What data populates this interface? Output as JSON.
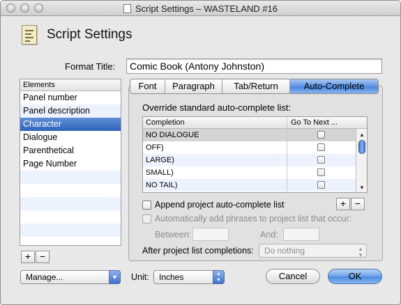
{
  "window": {
    "title": "Script Settings – WASTELAND #16"
  },
  "header": {
    "title": "Script Settings",
    "icon": "script-settings-icon"
  },
  "format_title": {
    "label": "Format Title:",
    "value": "Comic Book (Antony Johnston)"
  },
  "elements": {
    "header": "Elements",
    "items": [
      "Panel number",
      "Panel description",
      "Character",
      "Dialogue",
      "Parenthetical",
      "Page Number"
    ],
    "selected": "Character",
    "add_label": "+",
    "remove_label": "−"
  },
  "tabs": [
    "Font",
    "Paragraph",
    "Tab/Return",
    "Auto-Complete"
  ],
  "active_tab": "Auto-Complete",
  "auto_complete": {
    "override_label": "Override standard auto-complete list:",
    "columns": [
      "Completion",
      "Go To Next ..."
    ],
    "rows": [
      {
        "completion": "NO DIALOGUE",
        "go_to_next": false
      },
      {
        "completion": "OFF)",
        "go_to_next": false
      },
      {
        "completion": "LARGE)",
        "go_to_next": false
      },
      {
        "completion": "SMALL)",
        "go_to_next": false
      },
      {
        "completion": "NO TAIL)",
        "go_to_next": false
      }
    ],
    "add_label": "+",
    "remove_label": "−",
    "append_label": "Append project auto-complete list",
    "auto_add_label": "Automatically add phrases to project list that occur:",
    "between_label": "Between:",
    "and_label": "And:",
    "between_value": "",
    "and_value": "",
    "after_label": "After project list completions:",
    "after_value": "Do nothing"
  },
  "footer": {
    "manage_label": "Manage...",
    "unit_label": "Unit:",
    "unit_value": "Inches",
    "cancel_label": "Cancel",
    "ok_label": "OK"
  },
  "colors": {
    "accent": "#3d72cf",
    "selection": "#2f62b9"
  }
}
